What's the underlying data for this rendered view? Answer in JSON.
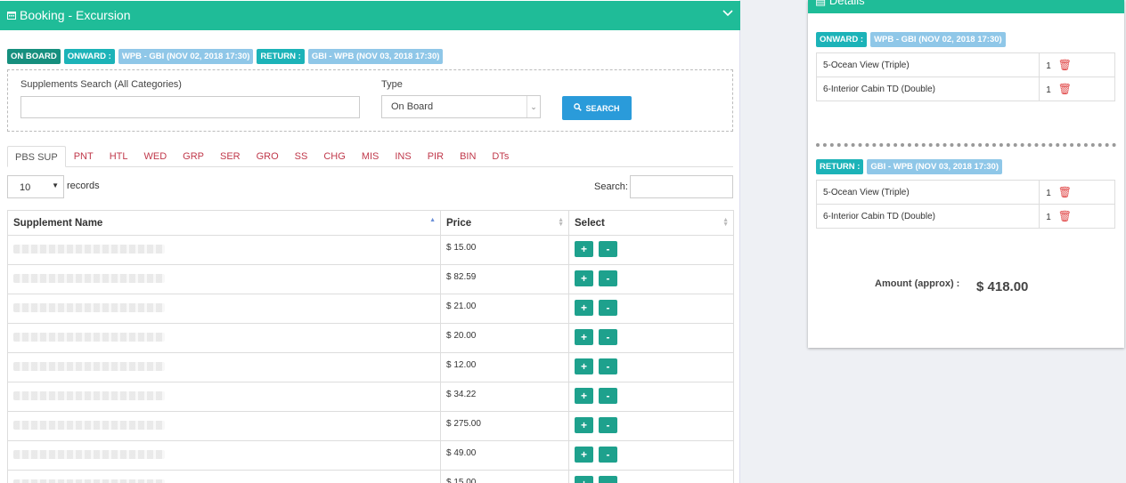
{
  "booking_panel": {
    "title": "Booking - Excursion",
    "tags": {
      "on_board": "ON BOARD",
      "onward_label": "ONWARD :",
      "onward_value": "WPB - GBI (NOV 02, 2018 17:30)",
      "return_label": "RETURN :",
      "return_value": "GBI - WPB (NOV 03, 2018 17:30)"
    },
    "search_form": {
      "supplements_label": "Supplements Search (All Categories)",
      "supplements_value": "",
      "type_label": "Type",
      "type_value": "On Board",
      "search_button": "SEARCH"
    },
    "tabs": [
      "PBS SUP",
      "PNT",
      "HTL",
      "WED",
      "GRP",
      "SER",
      "GRO",
      "SS",
      "CHG",
      "MIS",
      "INS",
      "PIR",
      "BIN",
      "DTs"
    ],
    "table_controls": {
      "page_length": "10",
      "records_label": "records",
      "search_label": "Search:"
    },
    "table": {
      "columns": [
        "Supplement Name",
        "Price",
        "Select"
      ],
      "prices": [
        "$ 15.00",
        "$ 82.59",
        "$ 21.00",
        "$ 20.00",
        "$ 12.00",
        "$ 34.22",
        "$ 275.00",
        "$ 49.00",
        "$ 15.00"
      ],
      "add_label": "+",
      "remove_label": "-"
    }
  },
  "details_panel": {
    "title": "Details",
    "onward": {
      "label": "ONWARD :",
      "route": "WPB - GBI (NOV 02, 2018 17:30)",
      "items": [
        {
          "name": "5-Ocean View (Triple)",
          "qty": "1"
        },
        {
          "name": "6-Interior Cabin TD (Double)",
          "qty": "1"
        }
      ]
    },
    "return": {
      "label": "RETURN :",
      "route": "GBI - WPB (NOV 03, 2018 17:30)",
      "items": [
        {
          "name": "5-Ocean View (Triple)",
          "qty": "1"
        },
        {
          "name": "6-Interior Cabin TD (Double)",
          "qty": "1"
        }
      ]
    },
    "amount_label": "Amount (approx) :",
    "amount_value": "$ 418.00"
  },
  "colors": {
    "header": "#1fbc98",
    "accent_button": "#2a9bda",
    "tab_text": "#c0394b",
    "delete_icon": "#e04545"
  }
}
